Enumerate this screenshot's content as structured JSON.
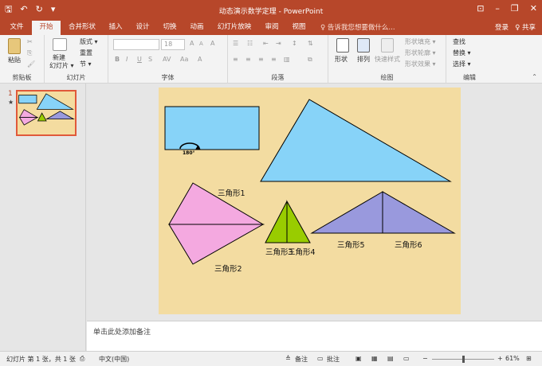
{
  "window": {
    "title": "动态演示数学定理 - PowerPoint",
    "qat": [
      "save-icon",
      "undo-icon",
      "repeat-icon",
      "customize-icon"
    ],
    "controls": [
      "ribbon-display-icon",
      "minimize-icon",
      "restore-icon",
      "close-icon"
    ]
  },
  "tabs": [
    "文件",
    "开始",
    "合并形状",
    "插入",
    "设计",
    "切换",
    "动画",
    "幻灯片放映",
    "审阅",
    "视图"
  ],
  "active_tab": "开始",
  "tellme": "♀ 告诉我您想要做什么...",
  "account": {
    "signin": "登录",
    "share": "♀ 共享"
  },
  "ribbon": {
    "clipboard": {
      "paste": "粘贴",
      "label": "剪贴板"
    },
    "slides": {
      "new_slide": "新建",
      "new_slide2": "幻灯片 ▾",
      "layout": "版式 ▾",
      "reset": "重置",
      "section": "节 ▾",
      "label": "幻灯片"
    },
    "font": {
      "name": "",
      "size": "18",
      "bold": "B",
      "italic": "I",
      "underline": "U",
      "strike": "S",
      "grow": "A",
      "shrink": "A",
      "clear": "A",
      "label": "字体"
    },
    "paragraph": {
      "label": "段落"
    },
    "drawing": {
      "shape": "形状",
      "arrange": "排列",
      "quick_styles": "快速样式",
      "fill": "形状填充 ▾",
      "outline": "形状轮廓 ▾",
      "effects": "形状效果 ▾",
      "label": "绘图"
    },
    "editing": {
      "find": "查找",
      "replace": "替换 ▾",
      "select": "选择 ▾",
      "label": "编辑"
    }
  },
  "thumbnails": {
    "number": "1",
    "star": "★"
  },
  "slide": {
    "rotate_label": "180°",
    "triangles": [
      "三角形1",
      "三角形2",
      "三角形3",
      "三角形4",
      "三角形5",
      "三角形6"
    ]
  },
  "notes_placeholder": "单击此处添加备注",
  "status": {
    "slide_pos": "幻灯片 第 1 张，共 1 张",
    "lang": "中文(中国)",
    "notes": "备注",
    "comments": "批注",
    "zoom": "61%"
  },
  "colors": {
    "accent": "#b7472a",
    "blue_shape": "#87d3f8",
    "pink_shape": "#f4a9e0",
    "green_shape": "#99cc00",
    "purple_shape": "#9999dd",
    "slide_bg": "#f3dca1"
  }
}
